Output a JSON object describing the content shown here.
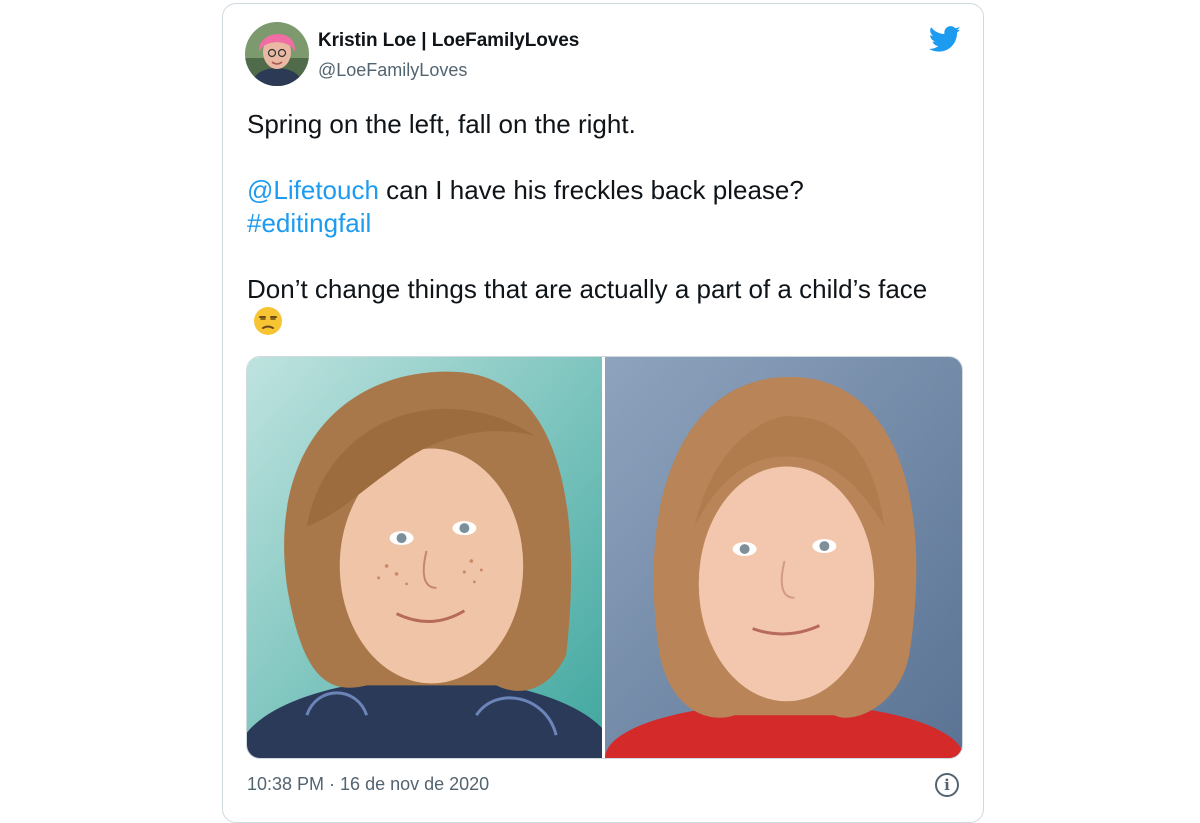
{
  "tweet": {
    "author_name": "Kristin Loe | LoeFamilyLoves",
    "author_handle": "@LoeFamilyLoves",
    "line1": "Spring on the left, fall on the right.",
    "mention": "@Lifetouch",
    "line2_rest": " can I have his freckles back please?",
    "hashtag": "#editingfail",
    "line3": "Don’t change things that are actually a part of a child’s face",
    "emoji": "unamused-face-emoji",
    "timestamp": "10:38 PM · 16 de nov de 2020",
    "info_glyph": "i"
  },
  "icons": {
    "brand": "twitter-bird-icon",
    "info": "info-icon"
  },
  "colors": {
    "link": "#1d9bf0",
    "text": "#0f1419",
    "muted": "#536471",
    "border": "#cfd9de",
    "brand": "#1d9bf0"
  },
  "media": {
    "photos": [
      "photo-spring",
      "photo-fall"
    ]
  }
}
